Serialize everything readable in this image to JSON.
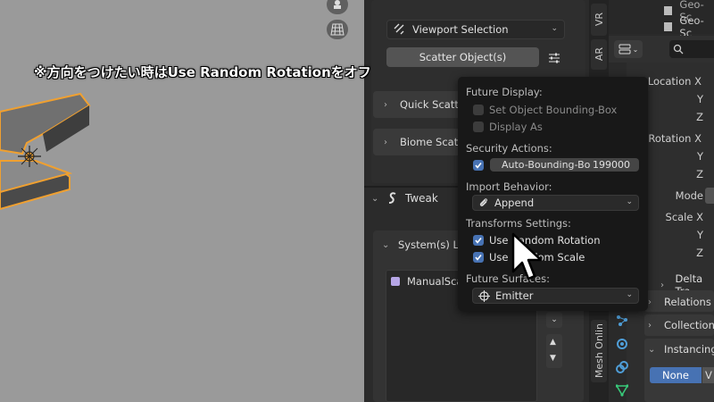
{
  "overlay_caption": "※方向をつけたい時はUse Random Rotationをオフ",
  "scatter_panel": {
    "selection_dropdown": "Viewport Selection",
    "scatter_button": "Scatter Object(s)",
    "quick_scatter": "Quick Scatte",
    "biome_scatter": "Biome Scatt",
    "tweak_header": "Tweak",
    "systems_list": "System(s) Li",
    "manual_scatter_item": "ManualSca"
  },
  "tab_strip": {
    "tabs": [
      "VR",
      "AR",
      "Mesh Onlin"
    ]
  },
  "outliner": {
    "items": [
      "Geo-Sc",
      "Geo-Sc"
    ]
  },
  "properties": {
    "search_placeholder": "",
    "location_label": "Location X",
    "loc_y": "Y",
    "loc_z": "Z",
    "rotation_label": "Rotation X",
    "rot_y": "Y",
    "rot_z": "Z",
    "mode_label": "Mode",
    "scale_label": "Scale X",
    "scale_y": "Y",
    "scale_z": "Z",
    "delta_transform": "Delta Tra",
    "relations": "Relations",
    "collections": "Collections",
    "instancing": "Instancing",
    "none_button": "None",
    "next_button": "V"
  },
  "popup": {
    "future_display_heading": "Future Display:",
    "set_bounding_box": "Set Object Bounding-Box",
    "display_as": "Display As",
    "security_heading": "Security Actions:",
    "auto_bounding_label": "Auto-Bounding-Bo",
    "auto_bounding_value": "199000",
    "import_heading": "Import Behavior:",
    "import_value": "Append",
    "transforms_heading": "Transforms Settings:",
    "use_random_rotation": "Use Random Rotation",
    "use_random_scale": "Use Random Scale",
    "future_surfaces_heading": "Future Surfaces:",
    "surface_value": "Emitter"
  },
  "colors": {
    "accent_blue": "#4772b3",
    "selection_orange": "#f0a030",
    "viewport_gray": "#9a9a9a"
  }
}
